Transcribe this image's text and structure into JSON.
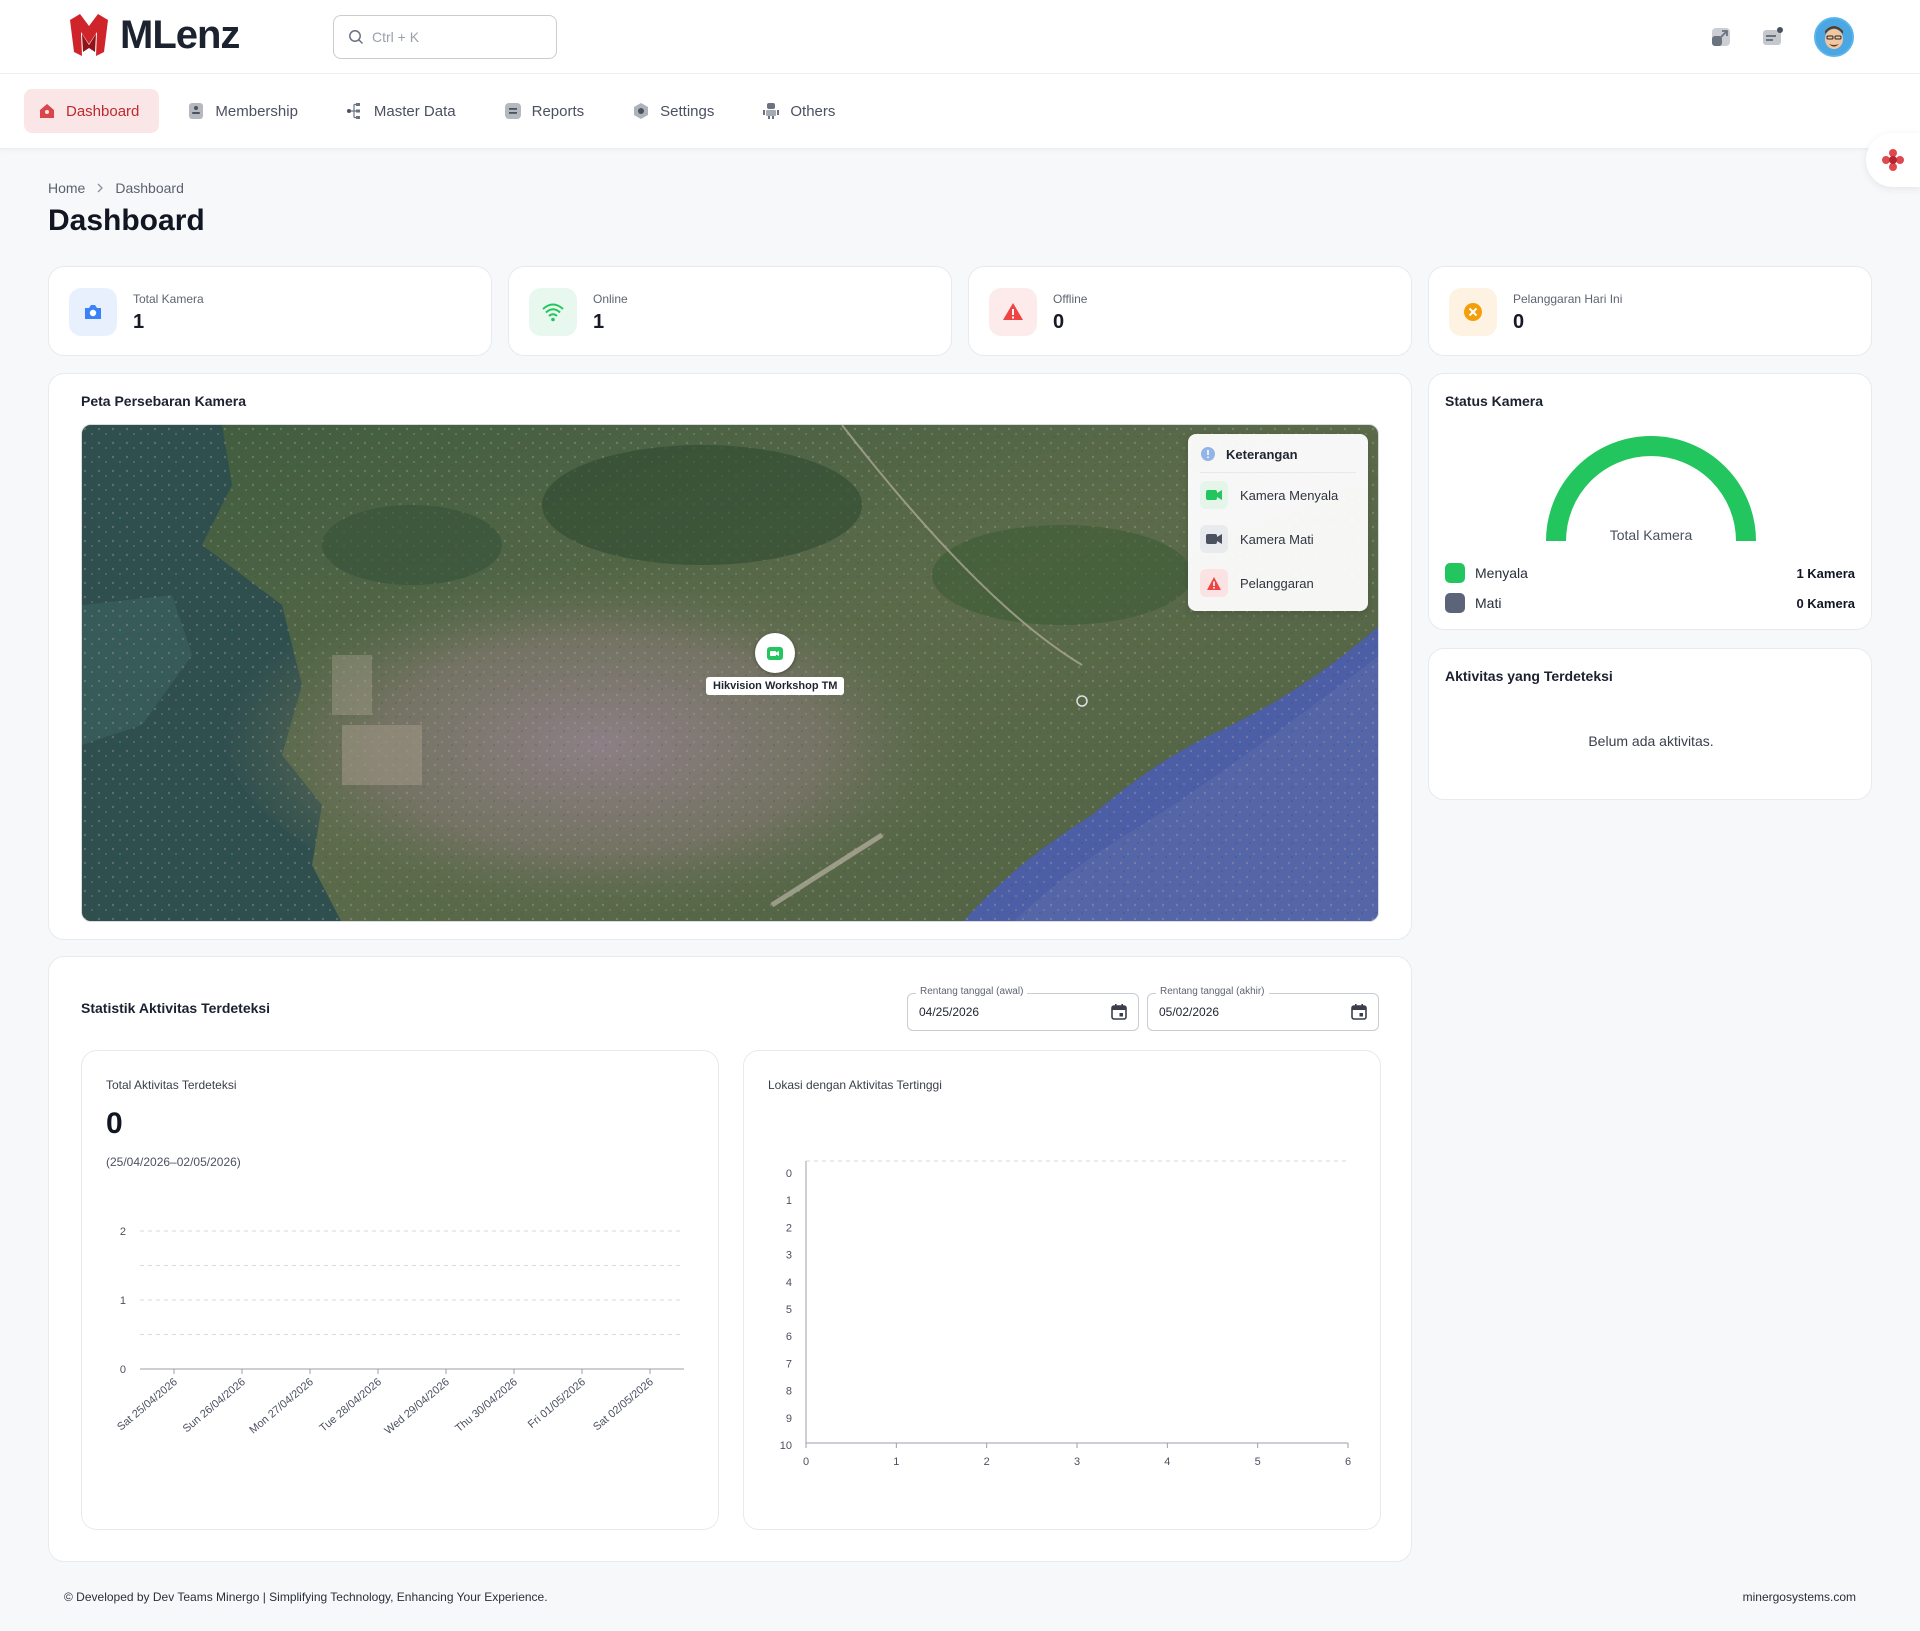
{
  "brand": {
    "name": "MLenz"
  },
  "search": {
    "placeholder": "Ctrl + K"
  },
  "nav": {
    "items": [
      {
        "label": "Dashboard",
        "icon": "home-icon",
        "active": true
      },
      {
        "label": "Membership",
        "icon": "id-card-icon"
      },
      {
        "label": "Master Data",
        "icon": "hierarchy-icon"
      },
      {
        "label": "Reports",
        "icon": "report-icon"
      },
      {
        "label": "Settings",
        "icon": "gear-icon"
      },
      {
        "label": "Others",
        "icon": "others-icon"
      }
    ]
  },
  "breadcrumb": {
    "home": "Home",
    "current": "Dashboard"
  },
  "page": {
    "title": "Dashboard"
  },
  "stats": [
    {
      "label": "Total Kamera",
      "value": "1",
      "icon": "camera-icon",
      "color": "#3b82f6",
      "bg": "#e8f0fe"
    },
    {
      "label": "Online",
      "value": "1",
      "icon": "wifi-icon",
      "color": "#22c55e",
      "bg": "#e8f8ee"
    },
    {
      "label": "Offline",
      "value": "0",
      "icon": "warning-icon",
      "color": "#ef4444",
      "bg": "#fdeaea"
    },
    {
      "label": "Pelanggaran Hari Ini",
      "value": "0",
      "icon": "x-circle-icon",
      "color": "#f59e0b",
      "bg": "#fef3e2"
    }
  ],
  "map_card": {
    "title": "Peta Persebaran Kamera",
    "legend": {
      "title": "Keterangan",
      "items": [
        {
          "label": "Kamera Menyala",
          "icon": "camera-on-icon",
          "color": "#22c55e"
        },
        {
          "label": "Kamera Mati",
          "icon": "camera-off-icon",
          "color": "#4b5160"
        },
        {
          "label": "Pelanggaran",
          "icon": "violation-icon",
          "color": "#ef4444"
        }
      ]
    },
    "marker": {
      "label": "Hikvision Workshop TM"
    }
  },
  "status_card": {
    "title": "Status Kamera",
    "gauge_label": "Total Kamera",
    "gauge_fraction": 1.0,
    "rows": [
      {
        "label": "Menyala",
        "count": "1 Kamera",
        "color": "#22c55e"
      },
      {
        "label": "Mati",
        "count": "0 Kamera",
        "color": "#5b6478"
      }
    ]
  },
  "activity_card": {
    "title": "Aktivitas yang Terdeteksi",
    "empty": "Belum ada aktivitas."
  },
  "stats_panel": {
    "title": "Statistik Aktivitas Terdeteksi",
    "date_start": {
      "label": "Rentang tanggal (awal)",
      "value": "04/25/2026"
    },
    "date_end": {
      "label": "Rentang tanggal (akhir)",
      "value": "05/02/2026"
    },
    "total": {
      "title": "Total Aktivitas Terdeteksi",
      "value": "0",
      "range": "(25/04/2026–02/05/2026)"
    },
    "top_location": {
      "title": "Lokasi dengan Aktivitas Tertinggi"
    }
  },
  "chart_data": [
    {
      "type": "line",
      "categories": [
        "Sat 25/04/2026",
        "Sun 26/04/2026",
        "Mon 27/04/2026",
        "Tue 28/04/2026",
        "Wed 29/04/2026",
        "Thu 30/04/2026",
        "Fri 01/05/2026",
        "Sat 02/05/2026"
      ],
      "series": [
        {
          "values": [
            0,
            0,
            0,
            0,
            0,
            0,
            0,
            0
          ]
        }
      ],
      "y_ticks": [
        "0",
        "1",
        "2"
      ],
      "ylim": [
        0,
        2
      ],
      "grid": true
    },
    {
      "type": "bar",
      "orientation": "horizontal",
      "categories": [],
      "x_ticks": [
        "0",
        "1",
        "2",
        "3",
        "4",
        "5",
        "6"
      ],
      "y_ticks": [
        "0",
        "1",
        "2",
        "3",
        "4",
        "5",
        "6",
        "7",
        "8",
        "9",
        "10"
      ],
      "xlim": [
        0,
        6
      ],
      "grid": true
    }
  ],
  "footer": {
    "left": "© Developed by Dev Teams Minergo | Simplifying Technology, Enhancing Your Experience.",
    "right": "minergosystems.com"
  }
}
